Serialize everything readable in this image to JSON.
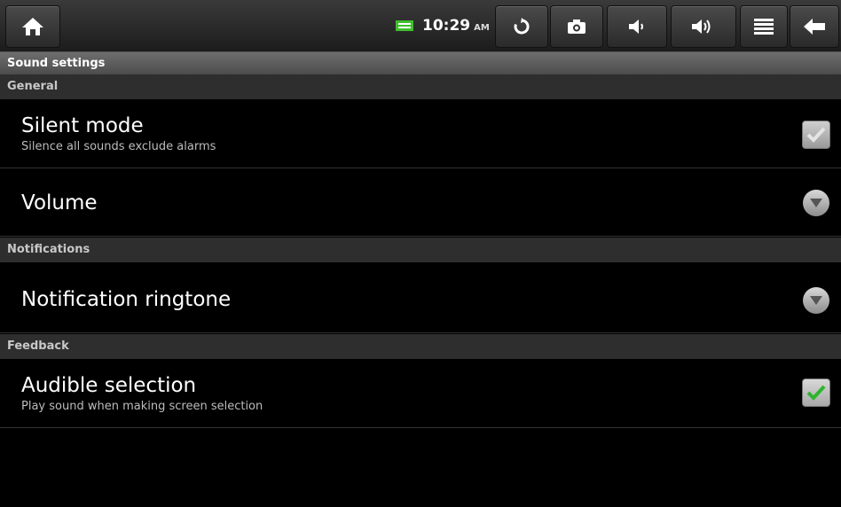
{
  "status_bar": {
    "time": "10:29",
    "ampm": "AM",
    "icons": [
      "home-icon",
      "battery-icon",
      "refresh-icon",
      "camera-icon",
      "volume-down-icon",
      "volume-up-icon",
      "menu-icon",
      "back-icon"
    ],
    "battery_color": "#3fbf2c"
  },
  "screen": {
    "title": "Sound settings"
  },
  "sections": [
    {
      "label": "General"
    },
    {
      "label": "Notifications"
    },
    {
      "label": "Feedback"
    }
  ],
  "items": [
    {
      "title": "Silent mode",
      "summary": "Silence all sounds exclude alarms",
      "checked": false
    },
    {
      "title": "Volume"
    },
    {
      "title": "Notification ringtone"
    },
    {
      "title": "Audible selection",
      "summary": "Play sound when making screen selection",
      "checked": true
    }
  ]
}
